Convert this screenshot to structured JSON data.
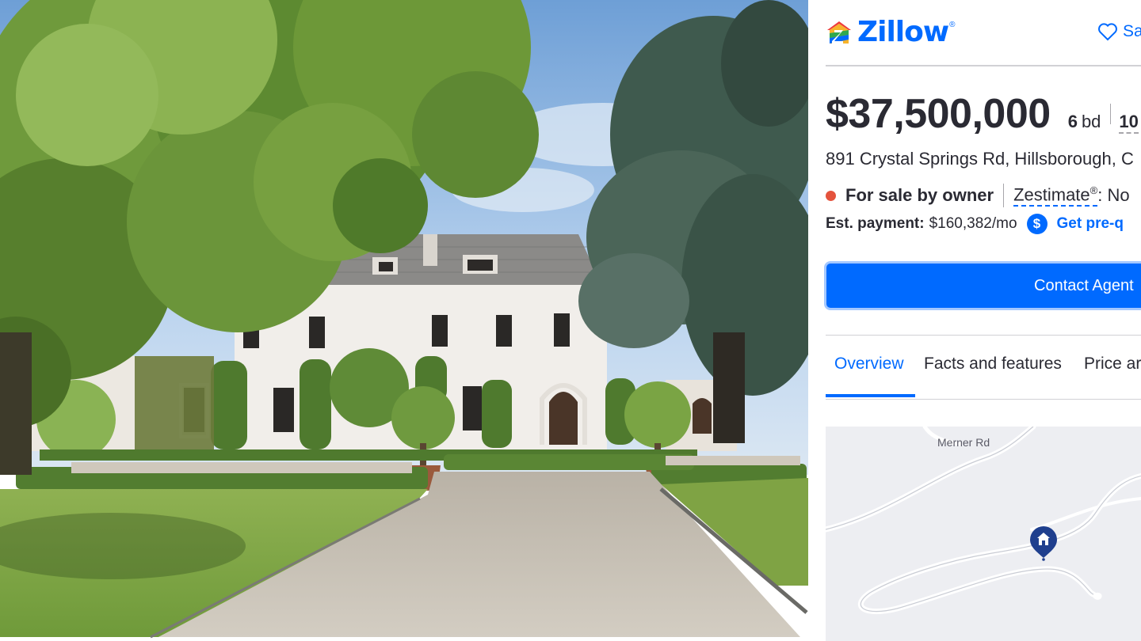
{
  "brand": {
    "name": "Zillow",
    "mark": "®",
    "color": "#006aff"
  },
  "header": {
    "save_label": "Sa",
    "save_icon": "heart-icon"
  },
  "listing": {
    "price": "$37,500,000",
    "beds_value": "6",
    "beds_unit": "bd",
    "baths_value": "10",
    "address": "891 Crystal Springs Rd, Hillsborough, C",
    "status": "For sale by owner",
    "status_color": "#e4533d",
    "zestimate_label": "Zestimate",
    "zestimate_mark": "®",
    "zestimate_value": ": No",
    "payment_label": "Est. payment:",
    "payment_value": "$160,382/mo",
    "prequal_icon": "$",
    "prequal_label": "Get pre-q"
  },
  "actions": {
    "contact_label": "Contact Agent"
  },
  "tabs": [
    {
      "label": "Overview",
      "active": true
    },
    {
      "label": "Facts and features",
      "active": false
    },
    {
      "label": "Price ar",
      "active": false
    }
  ],
  "map": {
    "road_label": "Merner Rd",
    "marker_icon": "home-marker-icon"
  },
  "photo": {
    "subject": "house-photo"
  }
}
